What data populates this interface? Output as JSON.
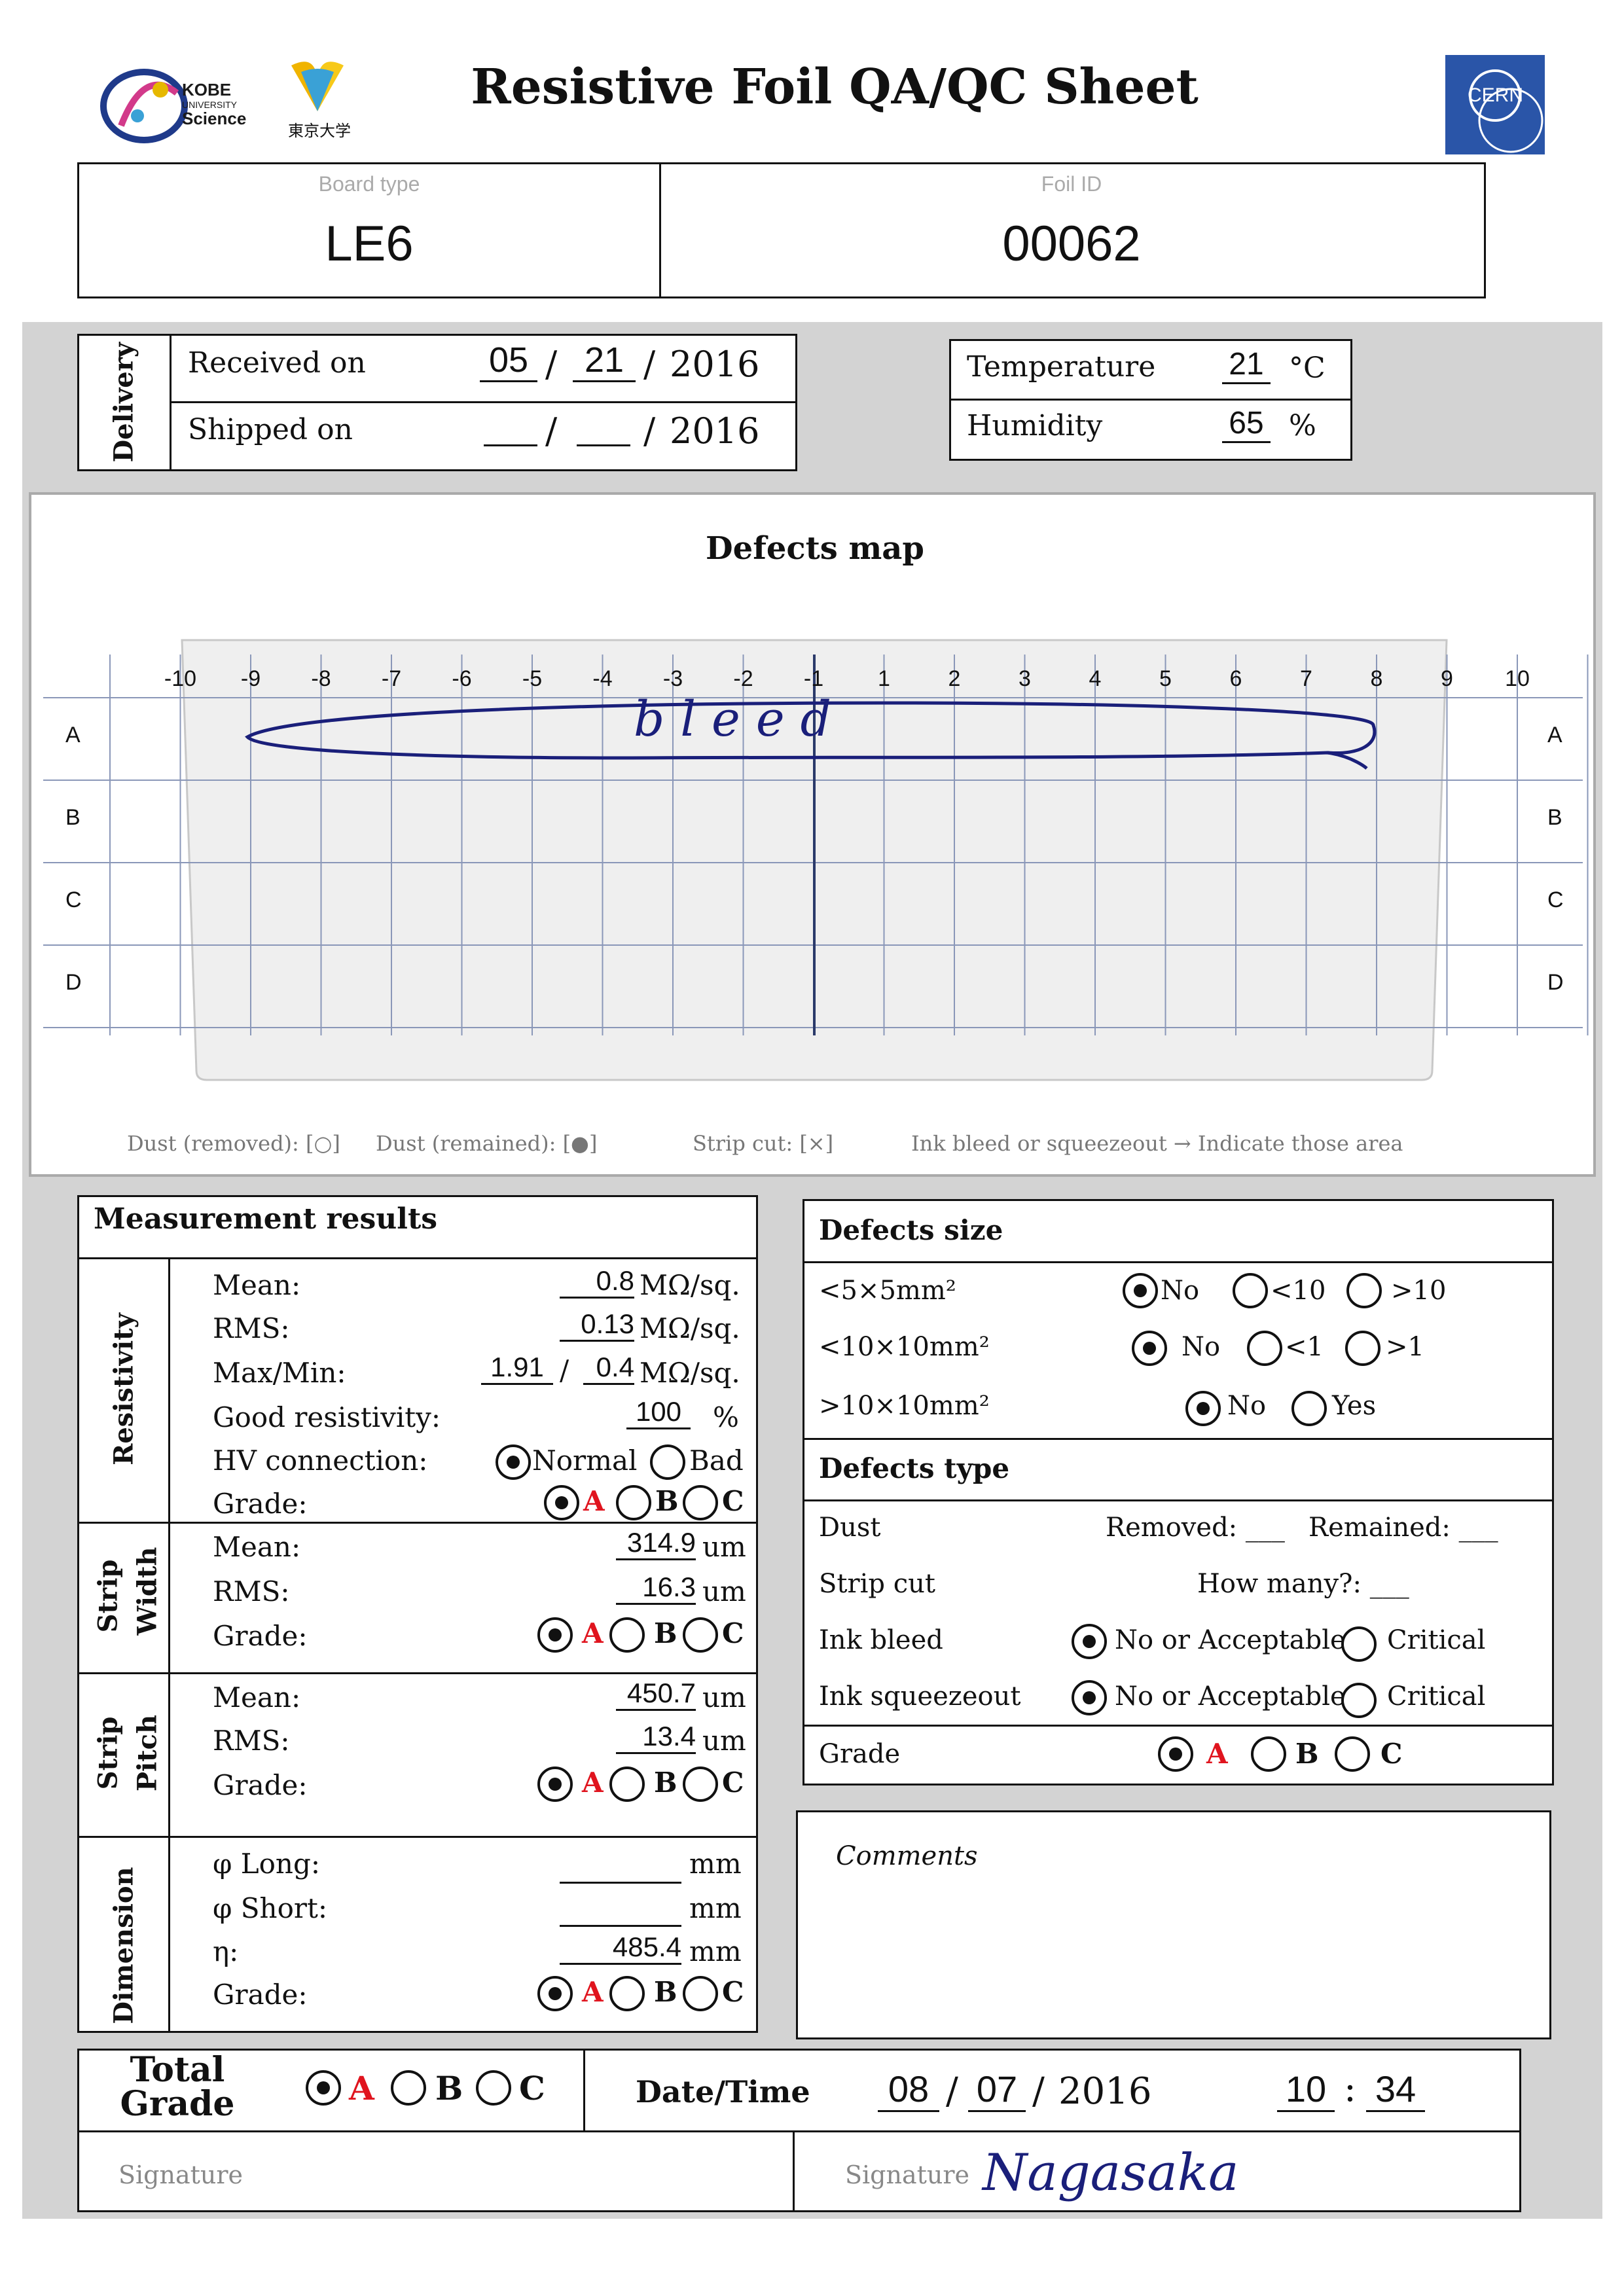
{
  "header": {
    "title": "Resistive Foil QA/QC Sheet",
    "kobe_logo": {
      "line1": "KOBE",
      "line2": "UNIVERSITY",
      "line3": "Science"
    },
    "tokyo_logo": {
      "text": "東京大学"
    },
    "cern_logo": {
      "text": "CERN"
    }
  },
  "board": {
    "board_type_label": "Board type",
    "board_type_value": "LE6",
    "foil_id_label": "Foil ID",
    "foil_id_value": "00062"
  },
  "delivery": {
    "section_label": "Delivery",
    "received_label": "Received on",
    "received_month": "05",
    "received_day": "21",
    "received_year": "2016",
    "shipped_label": "Shipped on",
    "shipped_year": "2016",
    "sep": "/"
  },
  "environment": {
    "temperature_label": "Temperature",
    "temperature_value": "21",
    "temperature_unit": "°C",
    "humidity_label": "Humidity",
    "humidity_value": "65",
    "humidity_unit": "%"
  },
  "defects_map": {
    "title": "Defects map",
    "columns": [
      "-10",
      "-9",
      "-8",
      "-7",
      "-6",
      "-5",
      "-4",
      "-3",
      "-2",
      "-1",
      "1",
      "2",
      "3",
      "4",
      "5",
      "6",
      "7",
      "8",
      "9",
      "10"
    ],
    "rows": [
      "A",
      "B",
      "C",
      "D"
    ],
    "annotation": "bleed",
    "legend": {
      "dust_removed": "Dust (removed): [○]",
      "dust_remained": "Dust (remained): [●]",
      "strip_cut": "Strip cut: [×]",
      "ink_bleed": "Ink bleed or squeezeout → Indicate those area"
    }
  },
  "measurement": {
    "title": "Measurement results",
    "resistivity": {
      "label": "Resistivity",
      "mean_label": "Mean:",
      "mean_value": "0.8",
      "mean_unit": "MΩ/sq.",
      "rms_label": "RMS:",
      "rms_value": "0.13",
      "rms_unit": "MΩ/sq.",
      "maxmin_label": "Max/Min:",
      "max_value": "1.91",
      "min_value": "0.4",
      "maxmin_unit": "MΩ/sq.",
      "good_label": "Good resistivity:",
      "good_value": "100",
      "good_unit": "%",
      "hv_label": "HV connection:",
      "hv_normal": "Normal",
      "hv_bad": "Bad",
      "grade_label": "Grade:"
    },
    "strip_width": {
      "label1": "Strip",
      "label2": "Width",
      "mean_label": "Mean:",
      "mean_value": "314.9",
      "mean_unit": "um",
      "rms_label": "RMS:",
      "rms_value": "16.3",
      "rms_unit": "um",
      "grade_label": "Grade:"
    },
    "strip_pitch": {
      "label1": "Strip",
      "label2": "Pitch",
      "mean_label": "Mean:",
      "mean_value": "450.7",
      "mean_unit": "um",
      "rms_label": "RMS:",
      "rms_value": "13.4",
      "rms_unit": "um",
      "grade_label": "Grade:"
    },
    "dimension": {
      "label": "Dimension",
      "phi_long_label": "φ Long:",
      "phi_long_unit": "mm",
      "phi_short_label": "φ Short:",
      "phi_short_unit": "mm",
      "eta_label": "η:",
      "eta_value": "485.4",
      "eta_unit": "mm",
      "grade_label": "Grade:"
    },
    "grade_options": [
      "A",
      "B",
      "C"
    ]
  },
  "defects_size": {
    "title": "Defects size",
    "r1_label": "<5×5mm²",
    "r1_opts": [
      "No",
      "<10",
      ">10"
    ],
    "r2_label": "<10×10mm²",
    "r2_opts": [
      "No",
      "<1",
      ">1"
    ],
    "r3_label": ">10×10mm²",
    "r3_opts": [
      "No",
      "Yes"
    ]
  },
  "defects_type": {
    "title": "Defects type",
    "dust_label": "Dust",
    "removed_label": "Removed: ___",
    "remained_label": "Remained: ___",
    "strip_cut_label": "Strip cut",
    "how_many_label": "How many?: ___",
    "ink_bleed_label": "Ink bleed",
    "ink_squeeze_label": "Ink squeezeout",
    "opt_ok": "No or Acceptable",
    "opt_critical": "Critical",
    "grade_label": "Grade",
    "grade_options": [
      "A",
      "B",
      "C"
    ]
  },
  "comments": {
    "label": "Comments"
  },
  "total": {
    "label1": "Total",
    "label2": "Grade",
    "grade_options": [
      "A",
      "B",
      "C"
    ],
    "datetime_label": "Date/Time",
    "month": "08",
    "day": "07",
    "year": "2016",
    "hour": "10",
    "minute": "34",
    "colon": ":",
    "signature_label_left": "Signature",
    "signature_label_right": "Signature",
    "signature_value": "Nagasaka"
  },
  "colors": {
    "ink": "#1a1f7a",
    "red": "#e0141e",
    "gray_band": "#d3d3d3",
    "cern_blue": "#2a55a8"
  }
}
